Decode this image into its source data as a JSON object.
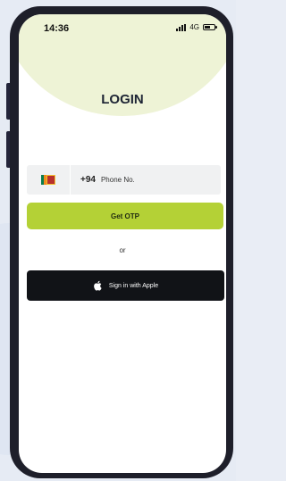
{
  "status": {
    "time": "14:36",
    "network": "4G"
  },
  "screen": {
    "title": "LOGIN"
  },
  "phone": {
    "country_flag": "sri-lanka-flag",
    "country_code": "+94",
    "placeholder": "Phone No."
  },
  "actions": {
    "otp_label": "Get OTP",
    "or_label": "or",
    "apple_label": "Sign in with Apple"
  },
  "colors": {
    "accent": "#b4d136",
    "hero": "#eef3d6",
    "apple_button": "#111317"
  }
}
